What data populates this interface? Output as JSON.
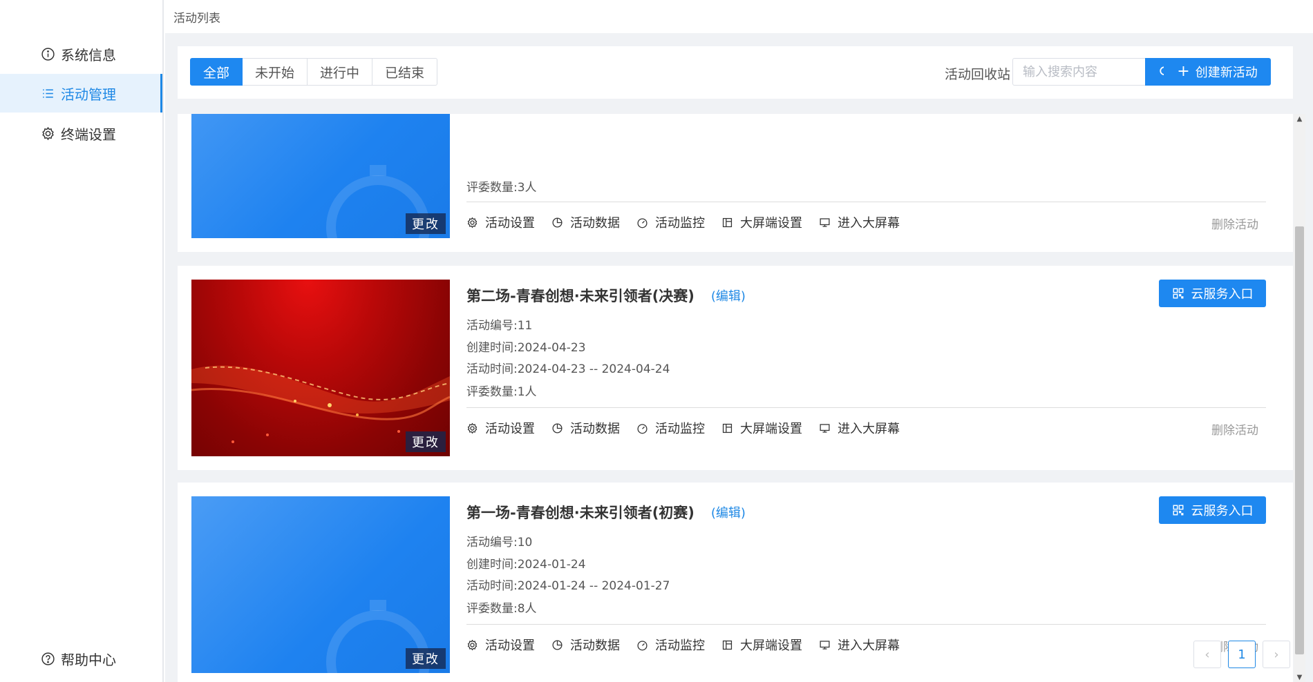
{
  "sidebar": {
    "items": [
      {
        "label": "系统信息",
        "icon": "info-icon"
      },
      {
        "label": "活动管理",
        "icon": "list-icon",
        "active": true
      },
      {
        "label": "终端设置",
        "icon": "gear-icon"
      }
    ],
    "help": {
      "label": "帮助中心",
      "icon": "question-icon"
    }
  },
  "breadcrumb": "活动列表",
  "toolbar": {
    "filters": [
      "全部",
      "未开始",
      "进行中",
      "已结束"
    ],
    "active_filter": "全部",
    "recycle_label": "活动回收站",
    "search_placeholder": "输入搜索内容",
    "search_value": "",
    "create_label": "创建新活动"
  },
  "labels": {
    "id": "活动编号:",
    "created": "创建时间:",
    "period": "活动时间:",
    "judges": "评委数量:",
    "edit_link": "(编辑)",
    "cloud": "云服务入口",
    "thumb_edit": "更改",
    "delete": "删除活动",
    "actions": [
      "活动设置",
      "活动数据",
      "活动监控",
      "大屏端设置",
      "进入大屏幕"
    ]
  },
  "activities": [
    {
      "judges": "3人",
      "thumb": "blue"
    },
    {
      "title": "第二场-青春创想·未来引领者(决赛)",
      "id": "11",
      "created": "2024-04-23",
      "period": "2024-04-23 -- 2024-04-24",
      "judges": "1人",
      "thumb": "red"
    },
    {
      "title": "第一场-青春创想·未来引领者(初赛)",
      "id": "10",
      "created": "2024-01-24",
      "period": "2024-01-24 -- 2024-01-27",
      "judges": "8人",
      "thumb": "blue"
    }
  ],
  "pagination": {
    "prev": "‹",
    "current": "1",
    "next": "›"
  },
  "colors": {
    "accent": "#1e88f0",
    "sidebar_active_bg": "#e6f2fd",
    "page_bg": "#f0f2f5"
  }
}
